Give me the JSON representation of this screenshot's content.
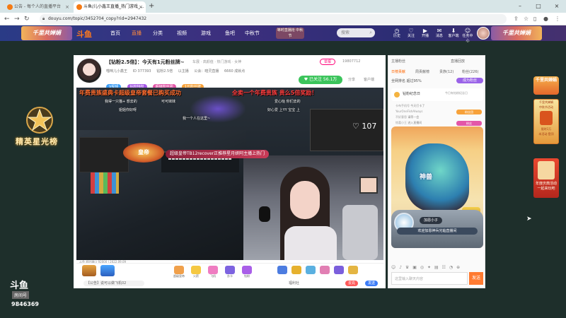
{
  "browser": {
    "tabs": [
      {
        "label": "公告 - 每个人的直播平台",
        "close": "×"
      },
      {
        "label": "斗鱼/儿小鑫王直播_热门游戏_...",
        "close": "×"
      }
    ],
    "new_tab": "+",
    "url": "douyu.com/topic/3452704_copy?rid=2947432",
    "window_controls": [
      "–",
      "□",
      "×"
    ]
  },
  "header": {
    "banner_left": "千里共婵娟",
    "logo": "斗鱼",
    "nav": [
      "首页",
      "直播",
      "分类",
      "视频",
      "游戏",
      "鱼吧",
      "中秋节"
    ],
    "nav_active_index": 1,
    "promo": "等时直播抢 中秋节",
    "search_placeholder": "搜索",
    "icons": [
      {
        "glyph": "◷",
        "label": "历史"
      },
      {
        "glyph": "♡",
        "label": "关注"
      },
      {
        "glyph": "▶",
        "label": "开播"
      },
      {
        "glyph": "✉",
        "label": "消息"
      },
      {
        "glyph": "⬇",
        "label": "客户端"
      },
      {
        "glyph": "☺",
        "label": "任务中心"
      }
    ],
    "banner_right": "千里共婵娟"
  },
  "left_deco": {
    "title": "精英星光榜",
    "watermark_logo": "斗鱼",
    "watermark_sub": "房间号",
    "room_number": "9846369"
  },
  "room": {
    "title": "【钻粉2.5倍】：今天有1元粉丝牌~",
    "tag": "车展 · 高颜值 · 热门游戏 · 女神",
    "report": "举报",
    "fans": "19807712",
    "meta": [
      "喵咪儿小鑫王",
      "ID 377393",
      "钻粉2.5倍",
      "以主播",
      "公会：暗灵直播",
      "6660 成就点"
    ],
    "badges": [
      {
        "label": "V视频",
        "color": "#3a9df7"
      },
      {
        "label": "钻粉特权",
        "color": "#a559e6"
      },
      {
        "label": "超级粉丝团",
        "color": "#e357a8"
      },
      {
        "label": "1元粉丝牌",
        "color": "#f7a23a"
      }
    ],
    "follow_label": "♥ 已关注 56.1万",
    "share": "分享",
    "download": "客户端"
  },
  "video": {
    "danmu": [
      {
        "text": "年费贵族盛典卡超级皇帝套餐已购买成功",
        "color": "#ff6b2c"
      },
      {
        "text": "全卖一个年费贵族 贵么5倍奖励！",
        "color": "#ff3b3b"
      },
      {
        "text": "超级皇帝TB12recover正推荐星月妍阿主播上热门",
        "color": "#ffffff"
      }
    ],
    "small_comments": [
      "我得一只猫+ 想去的",
      "可可妹妹",
      "姐姐你好呀",
      "好心爱 上YY 宝宝 上",
      "爱心哒 你们去的",
      "我一个人在这里~"
    ],
    "vip_emblem": "皇帝",
    "like_count": "♡ 107",
    "footer": "斗鱼 超时端口 92000 | 2022.09.09"
  },
  "gifts": [
    {
      "label": "超级皇帝",
      "color": "#f0a04b"
    },
    {
      "label": "火箭",
      "color": "#f5c842"
    },
    {
      "label": "飞机",
      "color": "#ef7cc1"
    },
    {
      "label": "办卡",
      "color": "#7d63e0"
    },
    {
      "label": "钻粉",
      "color": "#a95ee8"
    },
    {
      "label": "",
      "color": "#4c7ce0"
    },
    {
      "label": "",
      "color": "#e6b12e"
    },
    {
      "label": "",
      "color": "#5ab0e0"
    },
    {
      "label": "",
      "color": "#e17fb3"
    },
    {
      "label": "",
      "color": "#7b5fdc"
    },
    {
      "label": "",
      "color": "#e4b542"
    }
  ],
  "message_bar": {
    "input": "【公告】说可以做飞机02",
    "middle": "福利社",
    "gift_btn": "去充",
    "send_btn": "发送"
  },
  "chat": {
    "top_left": "主播粉丝",
    "top_right": "直播回放",
    "tabs": [
      "日榜贡献",
      "周贡献榜",
      "贵族(12)",
      "粉丝(226)"
    ],
    "active_tab_index": 0,
    "rank_text": "全网排名 超过95%",
    "rank_btn": "成为粉丝",
    "honor_title": "钻粉纪念日",
    "honor_sub": "今日有钻粉纪念日",
    "messages": [
      {
        "user": "卡布手机号",
        "text": "今天打卡了",
        "tag": "",
        "tag_color": ""
      },
      {
        "user": "YourOneFishAlways",
        "text": "",
        "tag": "粉丝团",
        "tag_color": "#f7a23a"
      },
      {
        "user": "不好意思",
        "text": "请等一会",
        "tag": "",
        "tag_color": ""
      },
      {
        "user": "惊喜小王",
        "text": "进入直播间",
        "tag": "粉丝",
        "tag_color": "#e357a8"
      }
    ],
    "dragon_title": "神兽",
    "player_name": "加恩小子",
    "welcome": "欢迎加恩神兵光临直播间",
    "tools": [
      "☺",
      "♪",
      "♛",
      "▣",
      "◎",
      "✦",
      "▤",
      "☷",
      "◔",
      "⊕"
    ],
    "input_placeholder": "这里输入聊天内容",
    "send": "发送"
  },
  "side_ads": {
    "ad1": "千里共婵娟",
    "ad2_lines": [
      "千里共婵娟",
      "中秋节活动",
      "限时1万",
      "本活动 登顶"
    ],
    "ad3_lines": [
      "年度庆典活动",
      "一起来玩吧"
    ]
  }
}
